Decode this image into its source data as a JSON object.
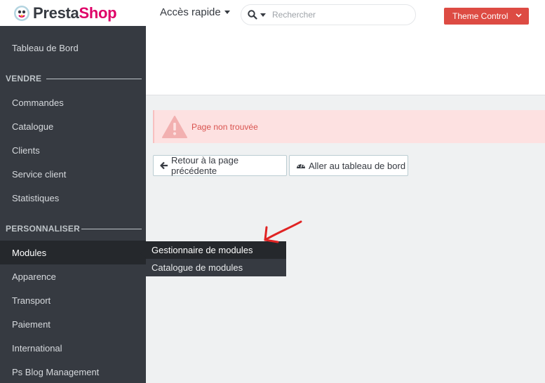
{
  "header": {
    "logo_text_main": "Presta",
    "logo_text_accent": "Shop",
    "quick_access_label": "Accès rapide",
    "search_placeholder": "Rechercher",
    "theme_button_label": "Theme Control"
  },
  "sidebar": {
    "dashboard": "Tableau de Bord",
    "section_sell": "VENDRE",
    "sell_items": [
      "Commandes",
      "Catalogue",
      "Clients",
      "Service client",
      "Statistiques"
    ],
    "section_customize": "PERSONNALISER",
    "customize_items": [
      "Modules",
      "Apparence",
      "Transport",
      "Paiement",
      "International",
      "Ps Blog Management"
    ]
  },
  "submenu": {
    "items": [
      "Gestionnaire de modules",
      "Catalogue de modules"
    ]
  },
  "alert": {
    "message": "Page non trouvée"
  },
  "actions": {
    "back_label": "Retour à la page précédente",
    "dashboard_label": "Aller au tableau de bord"
  },
  "colors": {
    "brand_pink": "#df0067",
    "sidebar_bg": "#363a41",
    "danger": "#dd4b43",
    "annotation": "#e02424"
  }
}
